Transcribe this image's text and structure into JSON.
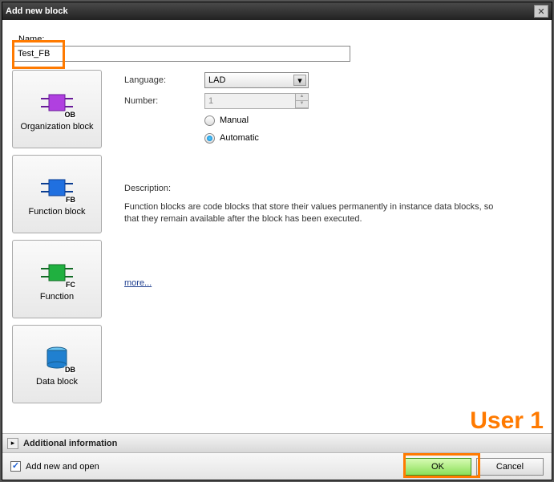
{
  "window": {
    "title": "Add new block"
  },
  "name": {
    "label": "Name:",
    "value": "Test_FB"
  },
  "blockTypes": [
    {
      "label": "Organization block",
      "tag": "OB",
      "color": "#b040e0"
    },
    {
      "label": "Function block",
      "tag": "FB",
      "color": "#2070e0"
    },
    {
      "label": "Function",
      "tag": "FC",
      "color": "#20b040"
    },
    {
      "label": "Data block",
      "tag": "DB",
      "color": "#2080d0"
    }
  ],
  "details": {
    "languageLabel": "Language:",
    "languageValue": "LAD",
    "numberLabel": "Number:",
    "numberValue": "1",
    "manualLabel": "Manual",
    "automaticLabel": "Automatic",
    "descTitle": "Description:",
    "descText": "Function blocks are code blocks that store their values permanently in instance data blocks, so that they remain available after the block has been executed.",
    "moreLabel": "more..."
  },
  "additional": {
    "title": "Additional information"
  },
  "footer": {
    "addOpenLabel": "Add new and open",
    "okLabel": "OK",
    "cancelLabel": "Cancel"
  },
  "annotation": {
    "user1": "User 1"
  }
}
